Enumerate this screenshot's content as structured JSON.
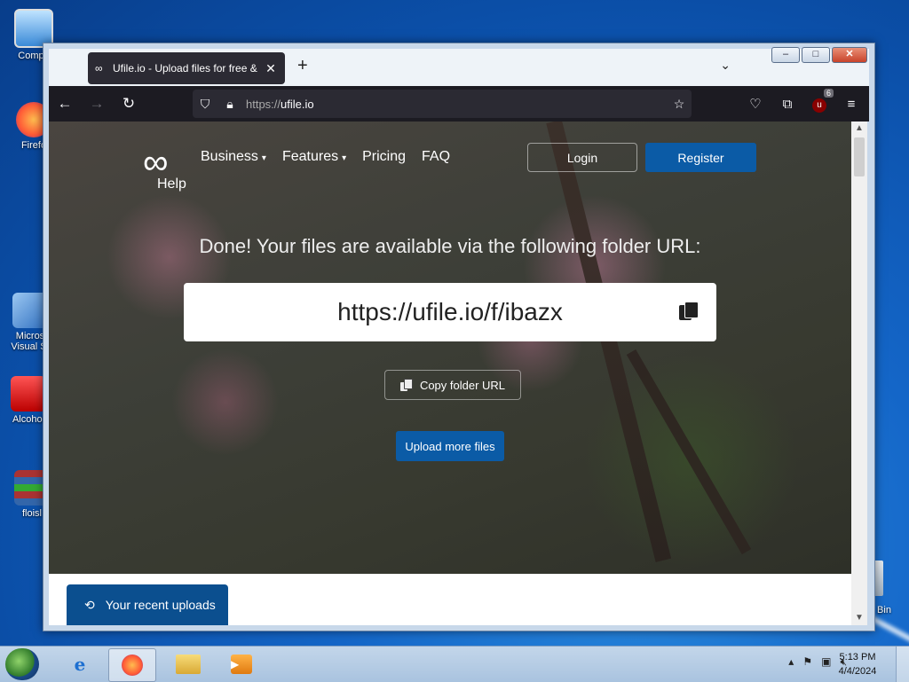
{
  "desktop": {
    "icons": [
      {
        "label": "Compu"
      },
      {
        "label": "Firefo"
      },
      {
        "label": "Micros Visual St"
      },
      {
        "label": "Alcohol"
      },
      {
        "label": "floisl"
      },
      {
        "label": "Bin"
      }
    ]
  },
  "browser": {
    "tab": {
      "title": "Ufile.io - Upload files for free &"
    },
    "new_tab_label": "+",
    "address": {
      "scheme": "https://",
      "host": "ufile.io"
    },
    "extension_badge": "6"
  },
  "page": {
    "logo_help": "Help",
    "nav": [
      {
        "label": "Business",
        "has_dropdown": true
      },
      {
        "label": "Features",
        "has_dropdown": true
      },
      {
        "label": "Pricing",
        "has_dropdown": false
      },
      {
        "label": "FAQ",
        "has_dropdown": false
      }
    ],
    "login_label": "Login",
    "register_label": "Register",
    "done_message": "Done! Your files are available via the following folder URL:",
    "folder_url": "https://ufile.io/f/ibazx",
    "copy_button_label": "Copy folder URL",
    "upload_more_label": "Upload more files",
    "recent_uploads_label": "Your recent uploads"
  },
  "taskbar": {
    "clock_time": "5:13 PM",
    "clock_date": "4/4/2024"
  },
  "colors": {
    "brand_button": "#0b5ba6",
    "recent_tab": "#0b4f8f",
    "browser_chrome": "#1c1b22"
  }
}
